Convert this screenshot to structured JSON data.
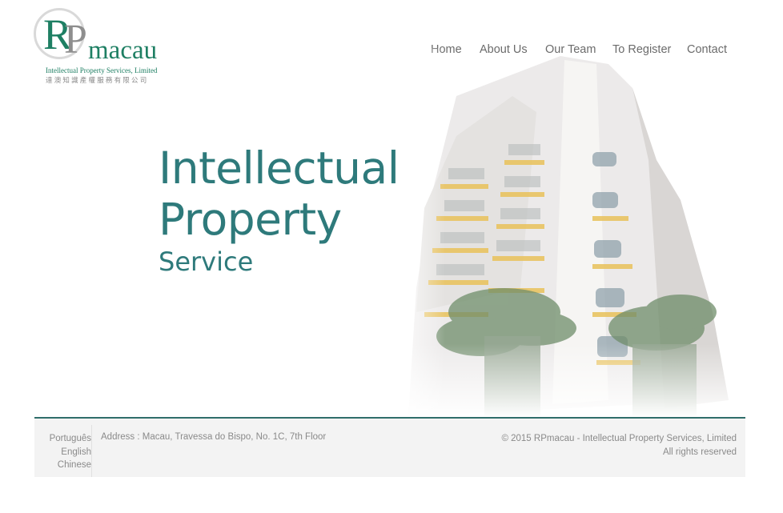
{
  "logo": {
    "letters_r": "R",
    "letters_p": "P",
    "word": "macau",
    "english_line": "Intellectual Property Services, Limited",
    "chinese_line": "達澳知識產權服務有限公司"
  },
  "nav": {
    "items": [
      {
        "label": "Home"
      },
      {
        "label": "About Us"
      },
      {
        "label": "Our Team"
      },
      {
        "label": "To Register"
      },
      {
        "label": "Contact"
      }
    ]
  },
  "hero": {
    "title_line1": "Intellectual",
    "title_line2": "Property",
    "subtitle": "Service",
    "image_subject": "watercolor-building"
  },
  "footer": {
    "languages": [
      "Português",
      "English",
      "Chinese"
    ],
    "address": "Address : Macau, Travessa do Bispo, No. 1C, 7th Floor",
    "copyright_line1": "© 2015 RPmacau - Intellectual Property Services, Limited",
    "copyright_line2": "All rights reserved"
  },
  "colors": {
    "brand_green": "#1e7f63",
    "hero_teal": "#2e7a7b",
    "footer_bg": "#f3f3f3",
    "divider": "#2f6e6b"
  }
}
